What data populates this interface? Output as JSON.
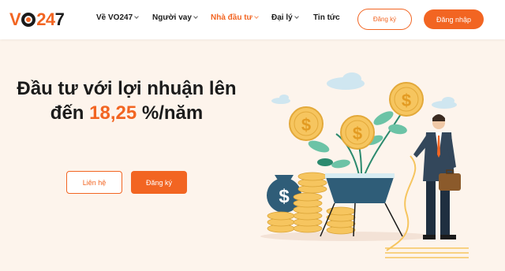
{
  "brand": {
    "logo_text": "VO247",
    "accent": "#f26522",
    "hero_bg": "#fdf4ec"
  },
  "nav": {
    "items": [
      {
        "label": "Về VO247",
        "dropdown": true,
        "active": false
      },
      {
        "label": "Người vay",
        "dropdown": true,
        "active": false
      },
      {
        "label": "Nhà đầu tư",
        "dropdown": true,
        "active": true
      },
      {
        "label": "Đại lý",
        "dropdown": true,
        "active": false
      },
      {
        "label": "Tin tức",
        "dropdown": false,
        "active": false
      }
    ],
    "register_label": "Đăng ký",
    "login_label": "Đăng nhập"
  },
  "hero": {
    "headline_line1": "Đầu tư với lợi nhuận lên",
    "headline_prefix": "đến ",
    "rate": "18,25",
    "headline_suffix": " %/năm",
    "contact_label": "Liên hệ",
    "register_label": "Đăng ký"
  },
  "illustration": {
    "subject": "money-tree-investor",
    "coin_symbol": "$"
  }
}
